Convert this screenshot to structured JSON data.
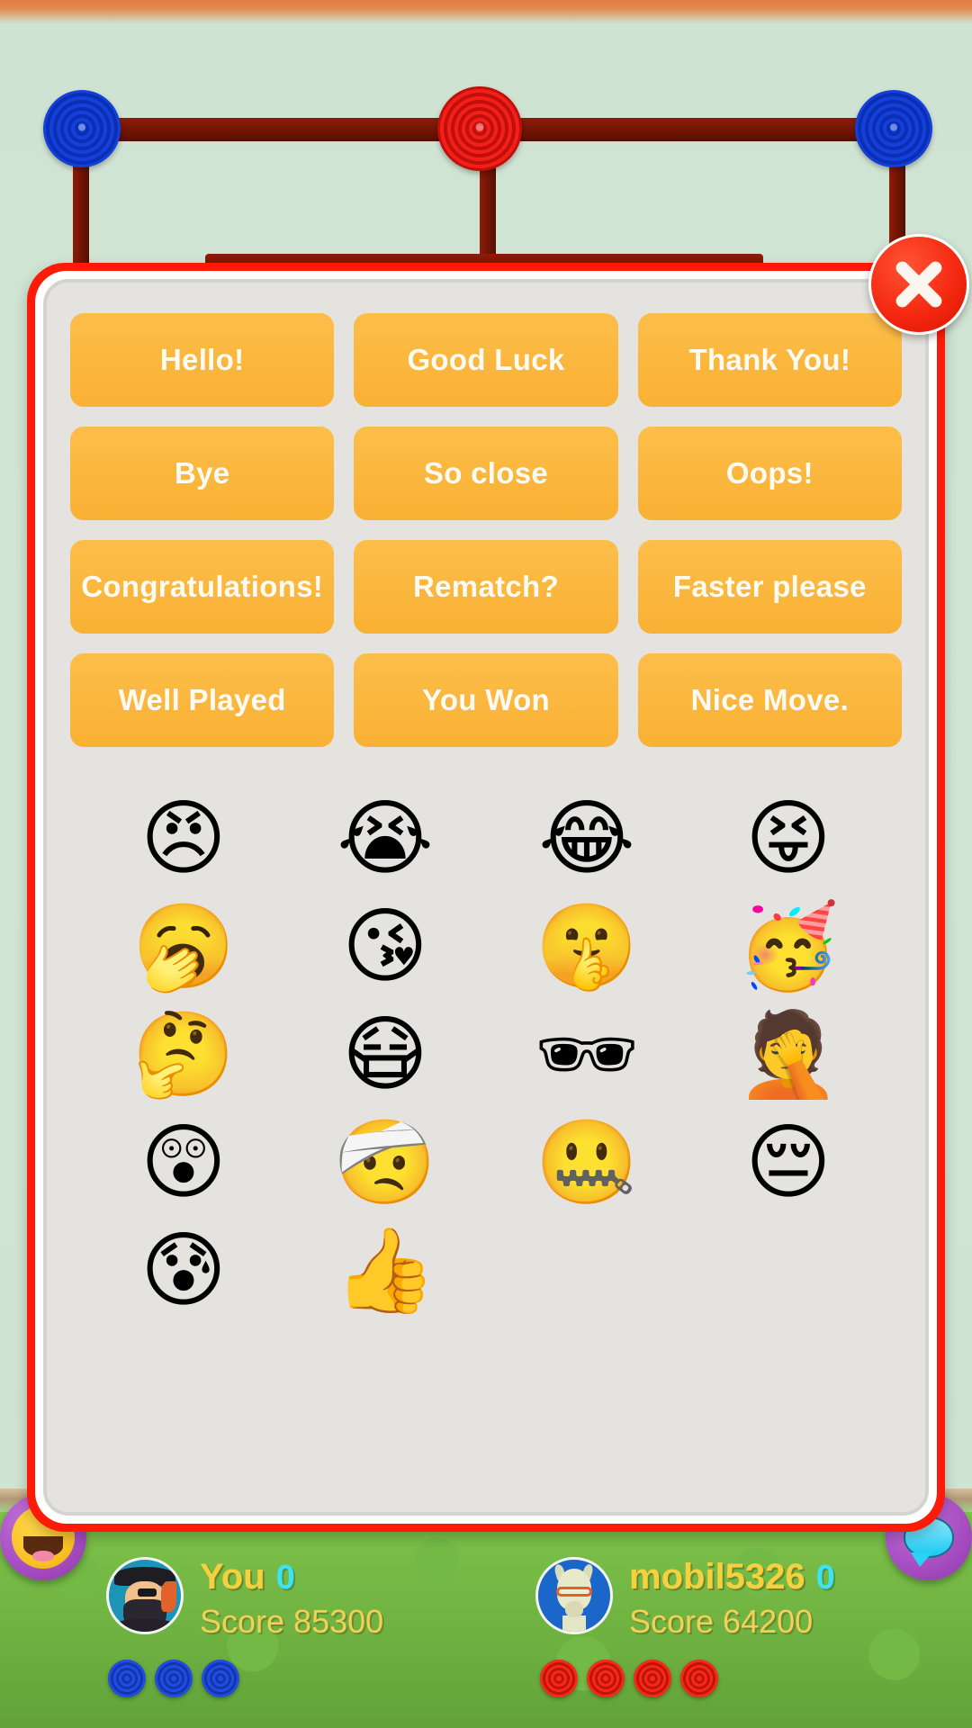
{
  "game": {
    "background_color": "#cfe3d3",
    "grass_color": "#74b845",
    "board_frame_color": "#6d1405"
  },
  "dialog": {
    "border_color": "#fb1b08",
    "panel_color": "#e4e3df",
    "close_label": "×",
    "close_icon": "close-icon"
  },
  "quick_messages": [
    {
      "label": "Hello!"
    },
    {
      "label": "Good Luck"
    },
    {
      "label": "Thank You!"
    },
    {
      "label": "Bye"
    },
    {
      "label": "So close"
    },
    {
      "label": "Oops!"
    },
    {
      "label": "Congratulations!"
    },
    {
      "label": "Rematch?"
    },
    {
      "label": "Faster please"
    },
    {
      "label": "Well Played"
    },
    {
      "label": "You Won"
    },
    {
      "label": "Nice Move."
    }
  ],
  "button_color": "#f9b133",
  "button_text_color": "#fffaf2",
  "emojis": [
    {
      "name": "angry-face-emoji",
      "glyph": "😠"
    },
    {
      "name": "loudly-crying-face-emoji",
      "glyph": "😭"
    },
    {
      "name": "face-with-tears-of-joy-emoji",
      "glyph": "😂"
    },
    {
      "name": "squinting-face-tongue-emoji",
      "glyph": "😝"
    },
    {
      "name": "yawning-face-emoji",
      "glyph": "🥱"
    },
    {
      "name": "face-blowing-kiss-emoji",
      "glyph": "😘"
    },
    {
      "name": "shushing-face-emoji",
      "glyph": "🤫"
    },
    {
      "name": "partying-face-emoji",
      "glyph": "🥳"
    },
    {
      "name": "thinking-face-emoji",
      "glyph": "🤔"
    },
    {
      "name": "face-with-medical-mask-emoji",
      "glyph": "😷"
    },
    {
      "name": "cool-sunglasses-face-emoji",
      "glyph": "🕶"
    },
    {
      "name": "face-palm-emoji",
      "glyph": "🤦"
    },
    {
      "name": "shocked-face-clock-emoji",
      "glyph": "😲"
    },
    {
      "name": "face-with-head-bandage-emoji",
      "glyph": "🤕"
    },
    {
      "name": "zipper-mouth-face-emoji",
      "glyph": "🤐"
    },
    {
      "name": "pensive-face-emoji",
      "glyph": "😔"
    },
    {
      "name": "anxious-face-with-sweat-emoji",
      "glyph": "😰"
    },
    {
      "name": "thumbs-up-emoji",
      "glyph": "👍"
    }
  ],
  "players": [
    {
      "name": "You",
      "count": "0",
      "score_label": "Score 85300",
      "avatar": "pirate-avatar",
      "puck_color": "#1f4de0",
      "pucks": 3
    },
    {
      "name": "mobil5326",
      "count": "0",
      "score_label": "Score 64200",
      "avatar": "llama-avatar",
      "puck_color": "#f42a18",
      "pucks": 4
    }
  ],
  "side_buttons": [
    {
      "name": "emoji-chat-button-left",
      "icon": "smiling-emoji-icon"
    },
    {
      "name": "message-chat-button-right",
      "icon": "chat-bubble-icon"
    }
  ]
}
